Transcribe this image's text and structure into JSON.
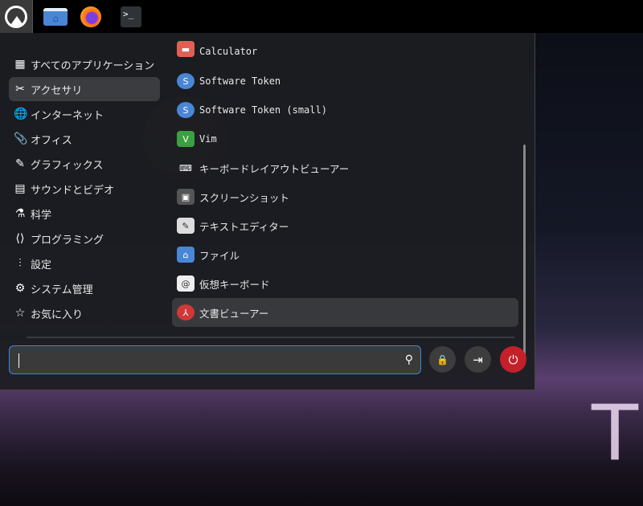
{
  "taskbar": {
    "items": [
      "start-menu",
      "file-manager",
      "firefox",
      "terminal"
    ],
    "terminal_glyph": ">_"
  },
  "categories": [
    {
      "label": "すべてのアプリケーション",
      "icon": "grid-icon",
      "glyph": "▦"
    },
    {
      "label": "アクセサリ",
      "icon": "tools-icon",
      "glyph": "✂",
      "selected": true
    },
    {
      "label": "インターネット",
      "icon": "globe-icon",
      "glyph": "🌐"
    },
    {
      "label": "オフィス",
      "icon": "paperclip-icon",
      "glyph": "📎"
    },
    {
      "label": "グラフィックス",
      "icon": "palette-icon",
      "glyph": "✎"
    },
    {
      "label": "サウンドとビデオ",
      "icon": "film-icon",
      "glyph": "▤"
    },
    {
      "label": "科学",
      "icon": "flask-icon",
      "glyph": "⚗"
    },
    {
      "label": "プログラミング",
      "icon": "code-icon",
      "glyph": "⟨⟩"
    },
    {
      "label": "設定",
      "icon": "sliders-icon",
      "glyph": "⫶"
    },
    {
      "label": "システム管理",
      "icon": "gear-icon",
      "glyph": "⚙"
    },
    {
      "label": "お気に入り",
      "icon": "star-icon",
      "glyph": "☆"
    }
  ],
  "apps": [
    {
      "label": "Calculator",
      "icon": "calculator-icon",
      "glyph": "▬",
      "mono": true
    },
    {
      "label": "Software Token",
      "icon": "token-icon",
      "glyph": "S",
      "mono": true
    },
    {
      "label": "Software Token (small)",
      "icon": "token-icon",
      "glyph": "S",
      "mono": true
    },
    {
      "label": "Vim",
      "icon": "vim-icon",
      "glyph": "V",
      "mono": true
    },
    {
      "label": "キーボードレイアウトビューアー",
      "icon": "keyboard-icon",
      "glyph": "⌨"
    },
    {
      "label": "スクリーンショット",
      "icon": "screenshot-icon",
      "glyph": "▣"
    },
    {
      "label": "テキストエディター",
      "icon": "text-editor-icon",
      "glyph": "✎"
    },
    {
      "label": "ファイル",
      "icon": "folder-icon",
      "glyph": "⌂"
    },
    {
      "label": "仮想キーボード",
      "icon": "virtual-keyboard-icon",
      "glyph": "@"
    },
    {
      "label": "文書ビューアー",
      "icon": "document-viewer-icon",
      "glyph": "⅄",
      "selected": true
    }
  ],
  "search": {
    "value": "",
    "placeholder": ""
  },
  "actions": {
    "lock": "🔒",
    "logout": "⇥",
    "power": "⏻"
  },
  "wallpaper": {
    "letter": "T"
  },
  "colors": {
    "accent": "#3d86d8",
    "power": "#c4202a"
  }
}
